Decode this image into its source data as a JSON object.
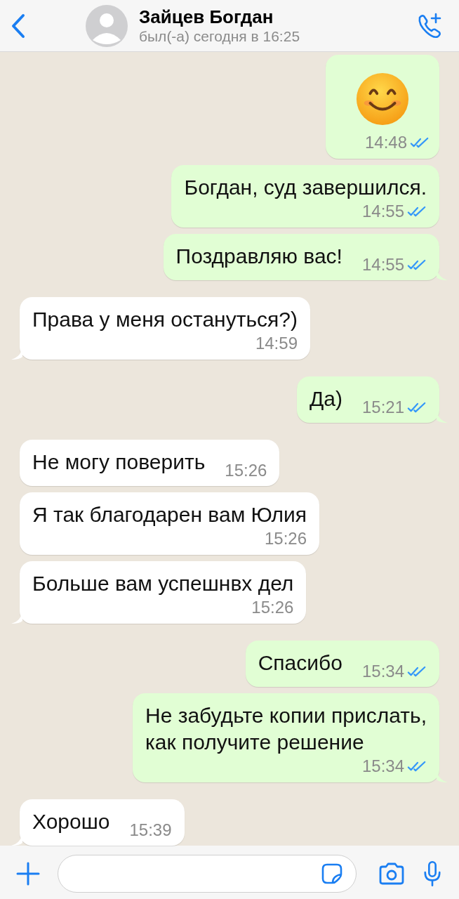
{
  "header": {
    "name": "Зайцев Богдан",
    "status": "был(-а) сегодня в 16:25"
  },
  "messages": [
    {
      "outgoing": true,
      "kind": "emoji",
      "time": "14:48",
      "read": true,
      "tail": false,
      "time_below": true
    },
    {
      "outgoing": true,
      "kind": "text",
      "text": "Богдан, суд завершился.",
      "time": "14:55",
      "read": true,
      "tail": false,
      "time_below": true
    },
    {
      "outgoing": true,
      "kind": "text",
      "text": "Поздравляю вас!",
      "time": "14:55",
      "read": true,
      "tail": true,
      "time_below": false
    },
    {
      "outgoing": false,
      "kind": "text",
      "text": "Права у меня остануться?)",
      "time": "14:59",
      "tail": true,
      "time_below": true
    },
    {
      "outgoing": true,
      "kind": "text",
      "text": "Да)",
      "time": "15:21",
      "read": true,
      "tail": true,
      "time_below": false
    },
    {
      "outgoing": false,
      "kind": "text",
      "text": "Не могу поверить",
      "time": "15:26",
      "tail": false,
      "time_below": false
    },
    {
      "outgoing": false,
      "kind": "text",
      "text": "Я так благодарен вам Юлия",
      "time": "15:26",
      "tail": false,
      "time_below": true
    },
    {
      "outgoing": false,
      "kind": "text",
      "text": "Больше вам успешнвх дел",
      "time": "15:26",
      "tail": true,
      "time_below": true
    },
    {
      "outgoing": true,
      "kind": "text",
      "text": "Спасибо",
      "time": "15:34",
      "read": true,
      "tail": false,
      "time_below": false
    },
    {
      "outgoing": true,
      "kind": "text",
      "text": "Не забудьте копии прислать,\nкак получите решение",
      "time": "15:34",
      "read": true,
      "tail": true,
      "time_below": true
    },
    {
      "outgoing": false,
      "kind": "text",
      "text": "Хорошо",
      "time": "15:39",
      "tail": true,
      "time_below": false
    }
  ]
}
